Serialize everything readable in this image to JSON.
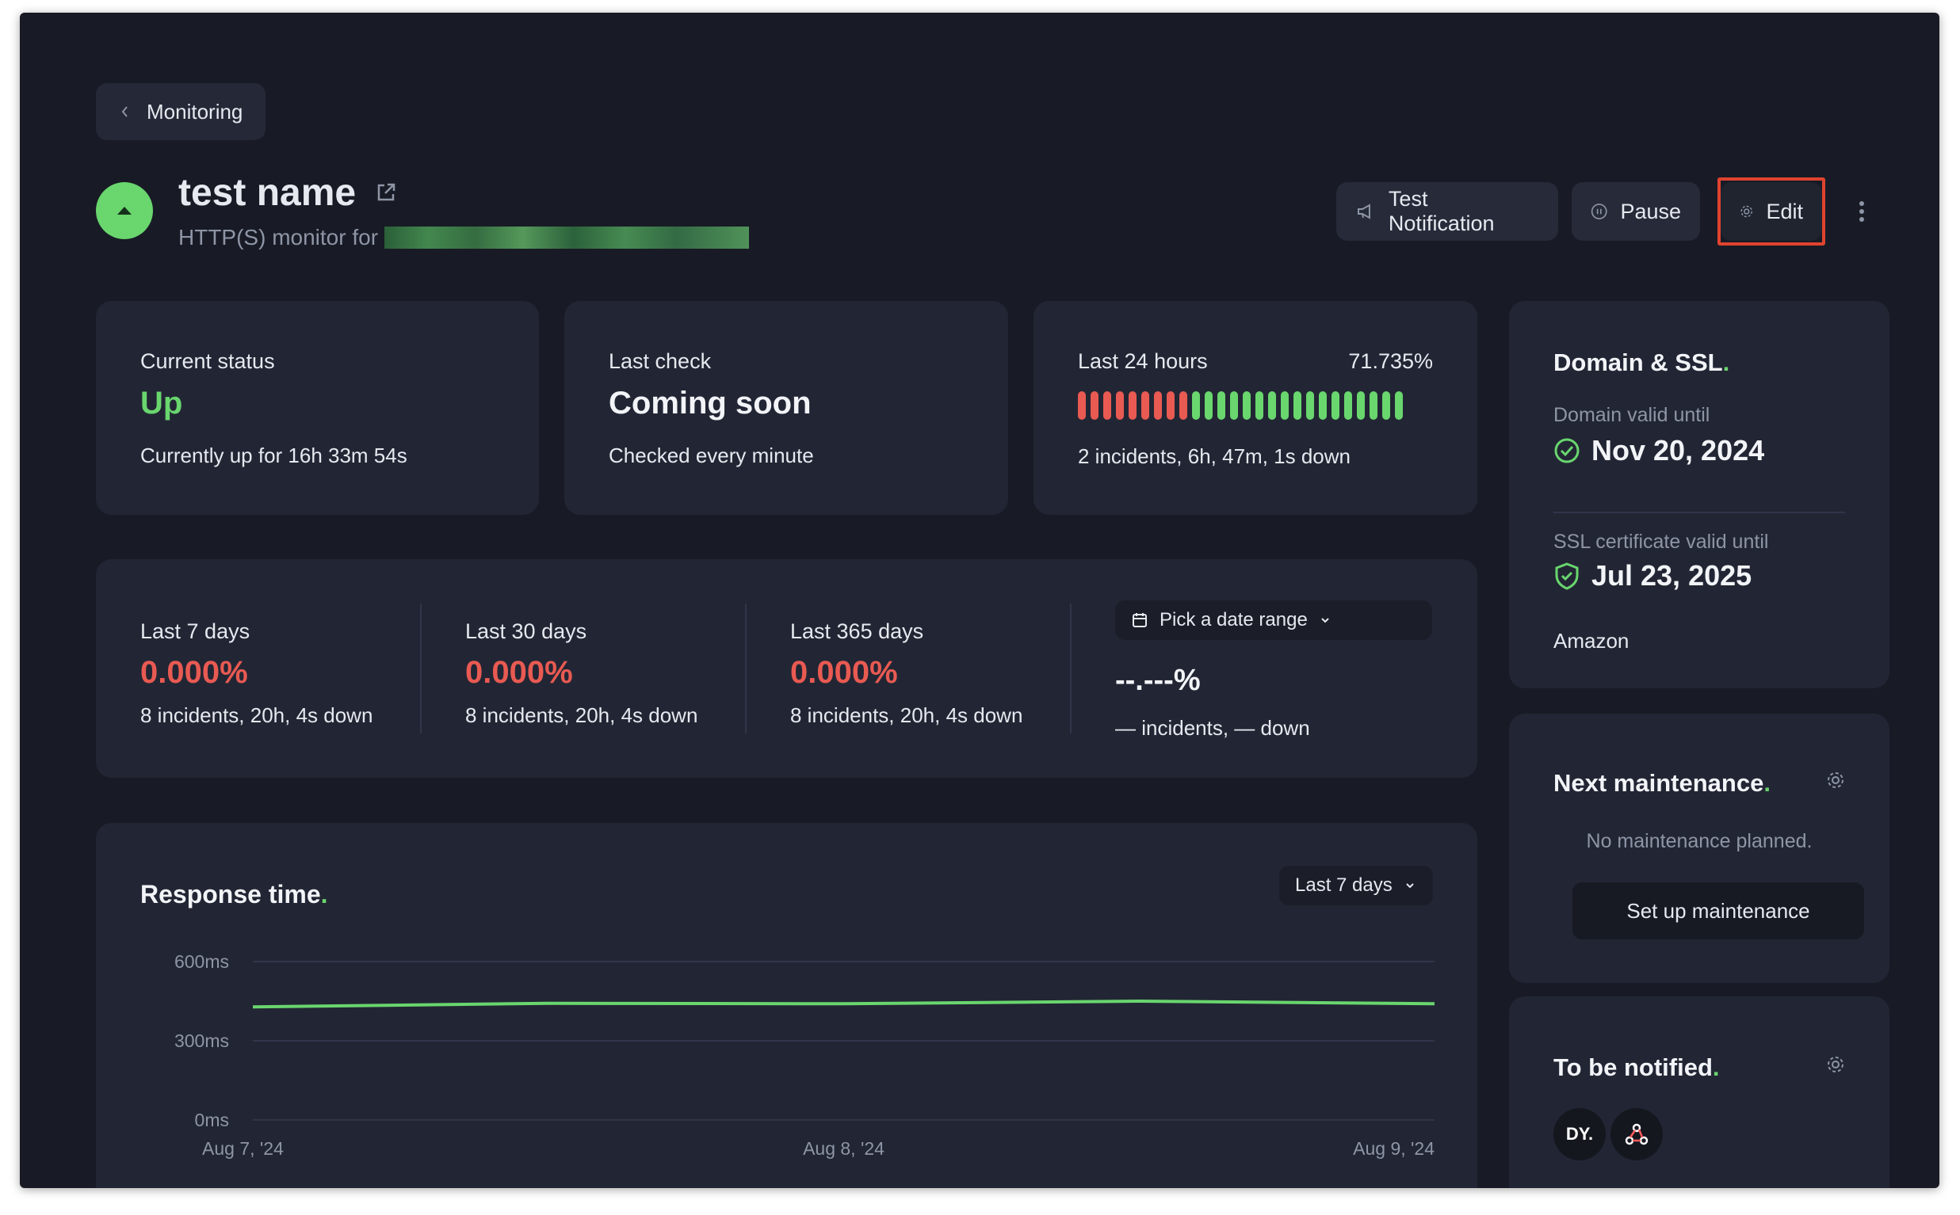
{
  "colors": {
    "background": "#181b25",
    "card": "#222634",
    "accent_green": "#69d66e",
    "accent_red": "#e85a52",
    "muted": "#8e95a6",
    "highlight": "#e0432f"
  },
  "back": {
    "label": "Monitoring",
    "icon": "chevron-left-icon"
  },
  "monitor": {
    "name": "test name",
    "subtitle_prefix": "HTTP(S) monitor for",
    "status_icon": "arrow-up-icon"
  },
  "actions": {
    "test_notification": "Test Notification",
    "pause": "Pause",
    "edit": "Edit",
    "more_icon": "kebab-icon"
  },
  "current_status": {
    "label": "Current status",
    "value": "Up",
    "detail": "Currently up for 16h 33m 54s"
  },
  "last_check": {
    "label": "Last check",
    "value": "Coming soon",
    "detail": "Checked every minute"
  },
  "last_24h": {
    "label": "Last 24 hours",
    "percent": "71.735%",
    "detail": "2 incidents, 6h, 47m, 1s down",
    "bars_down": 9,
    "bars_up": 17
  },
  "periods": [
    {
      "label": "Last 7 days",
      "percent": "0.000%",
      "detail": "8 incidents, 20h, 4s down"
    },
    {
      "label": "Last 30 days",
      "percent": "0.000%",
      "detail": "8 incidents, 20h, 4s down"
    },
    {
      "label": "Last 365 days",
      "percent": "0.000%",
      "detail": "8 incidents, 20h, 4s down"
    }
  ],
  "custom_range": {
    "picker_label": "Pick a date range",
    "percent": "--.---%",
    "detail": "— incidents, — down"
  },
  "response_time": {
    "title": "Response time",
    "range": "Last 7 days"
  },
  "chart_data": {
    "type": "line",
    "title": "Response time.",
    "xlabel": "",
    "ylabel": "",
    "ylim": [
      0,
      600
    ],
    "yticks": [
      "600ms",
      "300ms",
      "0ms"
    ],
    "xticks": [
      "Aug 7, '24",
      "Aug 8, '24",
      "Aug 9, '24"
    ],
    "grid": true,
    "series": [
      {
        "color": "#69d66e",
        "x": [
          "Aug 7, '24",
          "Aug 7, '24 12:00",
          "Aug 8, '24",
          "Aug 8, '24 12:00",
          "Aug 9, '24"
        ],
        "values": [
          428,
          442,
          440,
          450,
          440
        ]
      }
    ]
  },
  "domain_ssl": {
    "title": "Domain & SSL",
    "domain_label": "Domain valid until",
    "domain_date": "Nov 20, 2024",
    "ssl_label": "SSL certificate valid until",
    "ssl_date": "Jul 23, 2025",
    "issuer": "Amazon"
  },
  "maintenance": {
    "title": "Next maintenance",
    "empty": "No maintenance planned.",
    "button": "Set up maintenance"
  },
  "notify": {
    "title": "To be notified",
    "avatar_initials": "DY.",
    "webhook_icon": "webhook-icon"
  }
}
